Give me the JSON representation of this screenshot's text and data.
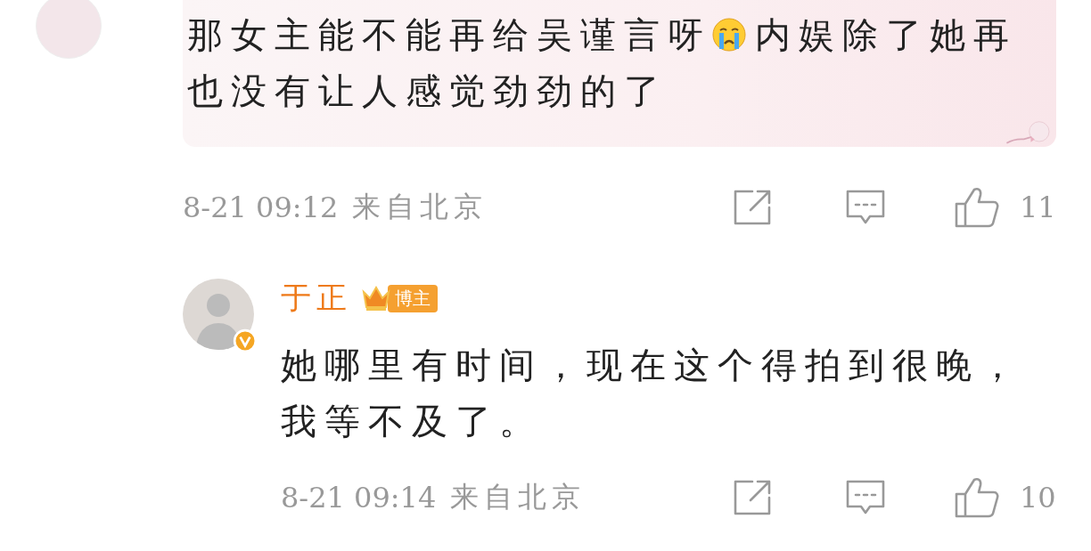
{
  "comment": {
    "text_parts": [
      {
        "kind": "text",
        "text": "那女主能不能再给吴谨言呀"
      },
      {
        "kind": "emoji"
      },
      {
        "kind": "text",
        "text": "内娱除了她再也没有让人感觉劲劲的了"
      }
    ],
    "time": "8-21 09:12",
    "location": "来自北京",
    "likes": "11"
  },
  "reply": {
    "author": "于正",
    "badge": "博主",
    "verified": true,
    "text": "她哪里有时间，现在这个得拍到很晚，我等不及了。",
    "time": "8-21 09:14",
    "location": "来自北京",
    "likes": "10"
  }
}
